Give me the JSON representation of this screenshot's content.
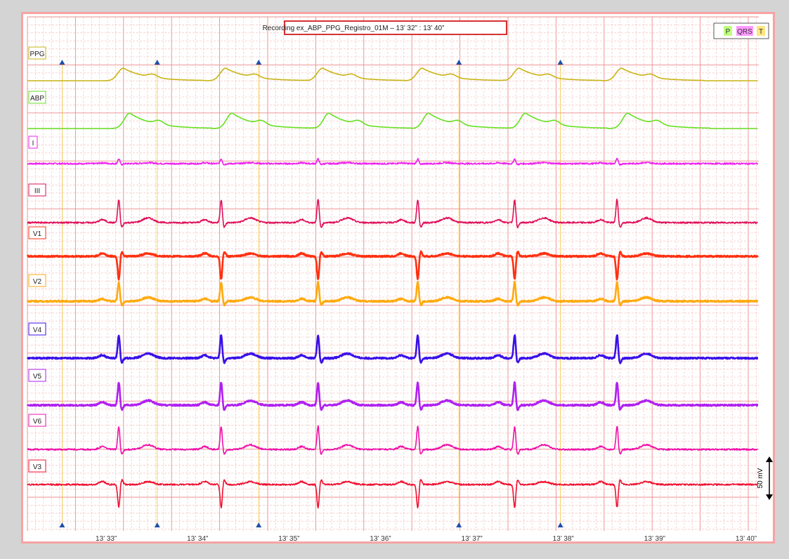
{
  "title": "Recording ex_ABP_PPG_Registro_01M – 13’ 32” : 13’ 40”",
  "legend": {
    "items": [
      "P",
      "QRS",
      "T"
    ],
    "colors": [
      "#bfff80",
      "#ff99ff",
      "#ffe680"
    ]
  },
  "scale_label": "50 mV",
  "colors": {
    "background": "#ffffff",
    "grid_major": "#ee8c8c",
    "grid_minor": "#f6b8b8",
    "outer": "#d4d4d4",
    "marker": "#1f4fa8"
  },
  "chart_data": {
    "type": "line",
    "x_unit": "seconds",
    "xlim": [
      32,
      40
    ],
    "x_tick_values": [
      33,
      34,
      35,
      36,
      37,
      38,
      39,
      40
    ],
    "x_tick_labels": [
      "13’ 33”",
      "13’ 34”",
      "13’ 35”",
      "13’ 36”",
      "13’ 37”",
      "13’ 38”",
      "13’ 39”",
      "13’ 40”"
    ],
    "beat_markers": [
      32.38,
      33.42,
      34.53,
      36.72,
      37.83
    ],
    "ecg_beats": [
      33.0,
      34.12,
      35.18,
      36.27,
      37.33,
      38.45
    ],
    "series": [
      {
        "name": "PPG",
        "color": "#c8b414",
        "kind": "ppg"
      },
      {
        "name": "ABP",
        "color": "#66e020",
        "kind": "abp"
      },
      {
        "name": "I",
        "color": "#ee22ee",
        "kind": "ecg_small"
      },
      {
        "name": "III",
        "color": "#e0105a",
        "kind": "ecg_up"
      },
      {
        "name": "V1",
        "color": "#ff3010",
        "kind": "ecg_down"
      },
      {
        "name": "V2",
        "color": "#ffaa10",
        "kind": "ecg_up"
      },
      {
        "name": "V4",
        "color": "#3a10e8",
        "kind": "ecg_up"
      },
      {
        "name": "V5",
        "color": "#b020f0",
        "kind": "ecg_up"
      },
      {
        "name": "V6",
        "color": "#f010a8",
        "kind": "ecg_up"
      },
      {
        "name": "V3",
        "color": "#f01030",
        "kind": "ecg_down"
      }
    ]
  }
}
